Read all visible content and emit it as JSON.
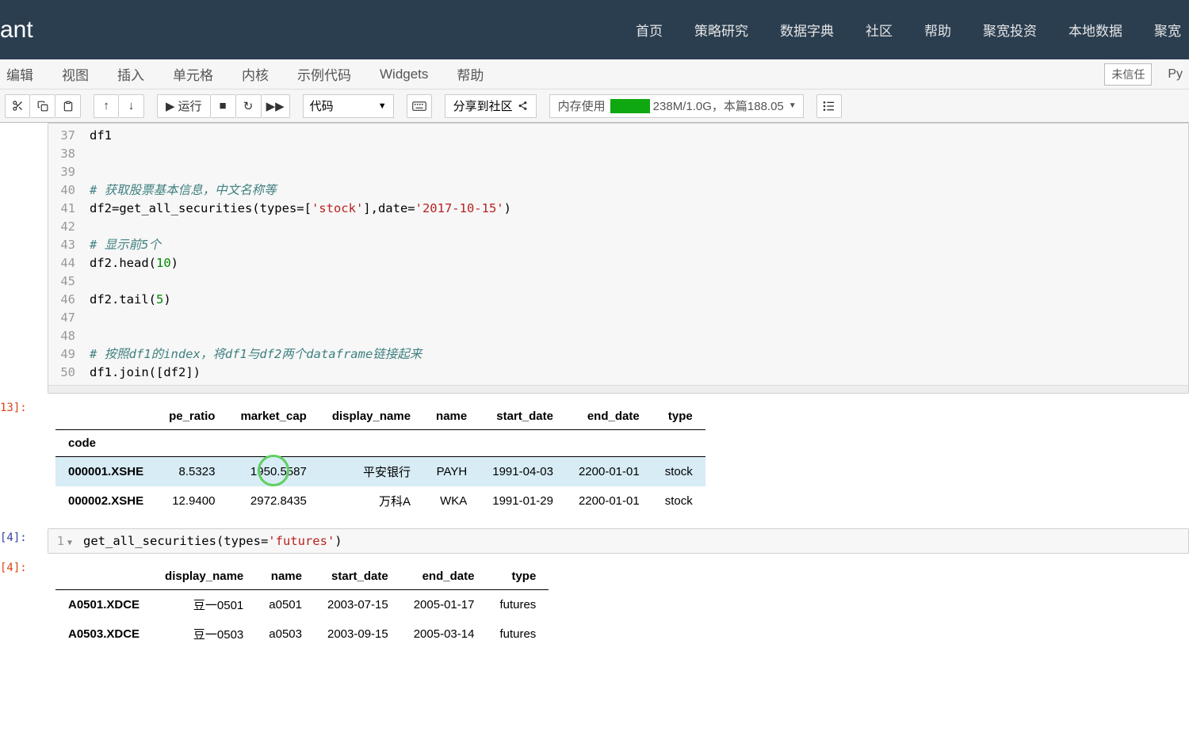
{
  "logo": "ant",
  "nav": [
    "首页",
    "策略研究",
    "数据字典",
    "社区",
    "帮助",
    "聚宽投资",
    "本地数据",
    "聚宽"
  ],
  "menu": [
    "编辑",
    "视图",
    "插入",
    "单元格",
    "内核",
    "示例代码",
    "Widgets",
    "帮助"
  ],
  "trust_label": "未信任",
  "kernel_label": "Py",
  "run_label": "运行",
  "celltype": "代码",
  "share_label": "分享到社区",
  "mem_prefix": "内存使用",
  "mem_text": "238M/1.0G，本篇188.05",
  "code_lines": {
    "37": "df1",
    "38": "",
    "39": "",
    "40_c": "# 获取股票基本信息，中文名称等",
    "41_a": "df2=get_all_securities(types=[",
    "41_s1": "'stock'",
    "41_b": "],date=",
    "41_s2": "'2017-10-15'",
    "41_c": ")",
    "42": "",
    "43_c": "# 显示前5个",
    "44_a": "df2.head(",
    "44_n": "10",
    "44_b": ")",
    "45": "",
    "46_a": "df2.tail(",
    "46_n": "5",
    "46_b": ")",
    "47": "",
    "48": "",
    "49_c": "# 按照df1的index，将df1与df2两个dataframe链接起来",
    "50": "df1.join([df2])"
  },
  "out13_prompt": "13]:",
  "out4_prompt": "[4]:",
  "in4_prompt": "[4]:",
  "table1": {
    "index_name": "code",
    "cols": [
      "pe_ratio",
      "market_cap",
      "display_name",
      "name",
      "start_date",
      "end_date",
      "type"
    ],
    "rows": [
      {
        "idx": "000001.XSHE",
        "vals": [
          "8.5323",
          "1950.5587",
          "平安银行",
          "PAYH",
          "1991-04-03",
          "2200-01-01",
          "stock"
        ],
        "sel": true,
        "circle_col": 1
      },
      {
        "idx": "000002.XSHE",
        "vals": [
          "12.9400",
          "2972.8435",
          "万科A",
          "WKA",
          "1991-01-29",
          "2200-01-01",
          "stock"
        ]
      }
    ]
  },
  "cell4_a": "get_all_securities(types=",
  "cell4_s": "'futures'",
  "cell4_b": ")",
  "table2": {
    "cols": [
      "display_name",
      "name",
      "start_date",
      "end_date",
      "type"
    ],
    "rows": [
      {
        "idx": "A0501.XDCE",
        "vals": [
          "豆一0501",
          "a0501",
          "2003-07-15",
          "2005-01-17",
          "futures"
        ]
      },
      {
        "idx": "A0503.XDCE",
        "vals": [
          "豆一0503",
          "a0503",
          "2003-09-15",
          "2005-03-14",
          "futures"
        ]
      }
    ]
  }
}
